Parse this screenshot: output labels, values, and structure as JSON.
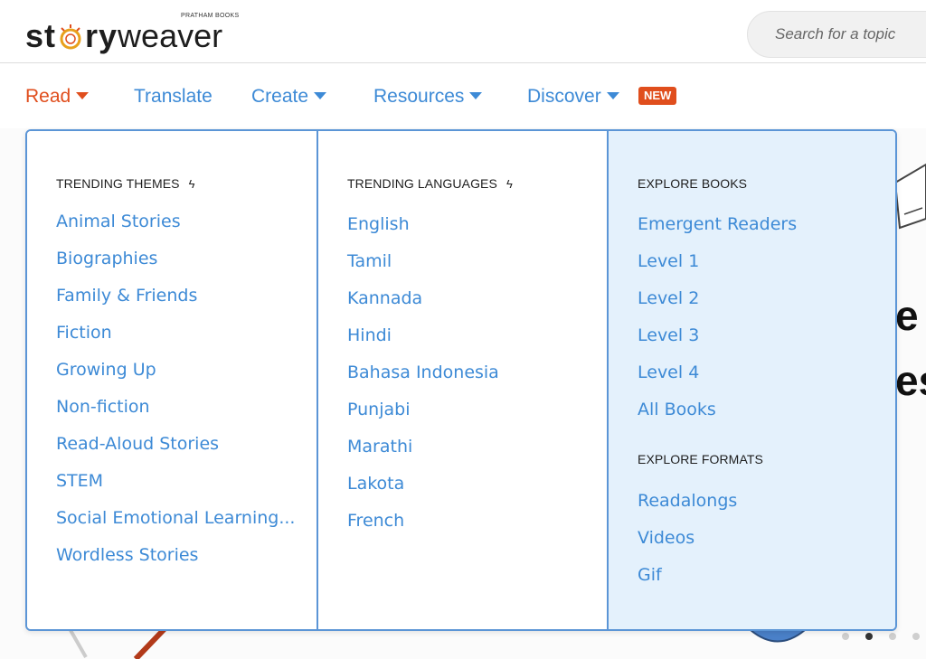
{
  "brand": {
    "publisher": "PRATHAM BOOKS",
    "name_part1": "st",
    "name_part2": "ry",
    "name_part3": "weaver",
    "accent_color": "#e04e1d"
  },
  "search": {
    "placeholder": "Search for a topic"
  },
  "nav": {
    "read": "Read",
    "translate": "Translate",
    "create": "Create",
    "resources": "Resources",
    "discover": "Discover",
    "new_badge": "NEW"
  },
  "dropdown": {
    "themes": {
      "heading": "TRENDING THEMES",
      "items": [
        "Animal Stories",
        "Biographies",
        "Family & Friends",
        "Fiction",
        "Growing Up",
        "Non-fiction",
        "Read-Aloud Stories",
        "STEM",
        "Social Emotional Learning...",
        "Wordless Stories"
      ]
    },
    "languages": {
      "heading": "TRENDING LANGUAGES",
      "items": [
        "English",
        "Tamil",
        "Kannada",
        "Hindi",
        "Bahasa Indonesia",
        "Punjabi",
        "Marathi",
        "Lakota",
        "French"
      ]
    },
    "explore_books": {
      "heading": "EXPLORE BOOKS",
      "items": [
        "Emergent Readers",
        "Level 1",
        "Level 2",
        "Level 3",
        "Level 4",
        "All Books"
      ]
    },
    "explore_formats": {
      "heading": "EXPLORE FORMATS",
      "items": [
        "Readalongs",
        "Videos",
        "Gif"
      ]
    }
  },
  "hero": {
    "text_1": "e",
    "text_2": "es"
  },
  "carousel": {
    "slide_count": 4,
    "active_index": 1
  },
  "colors": {
    "link": "#3d8ad6",
    "active": "#e04e1d",
    "panel_border": "#5b95d6",
    "panel_highlight": "#e4f1fc"
  }
}
